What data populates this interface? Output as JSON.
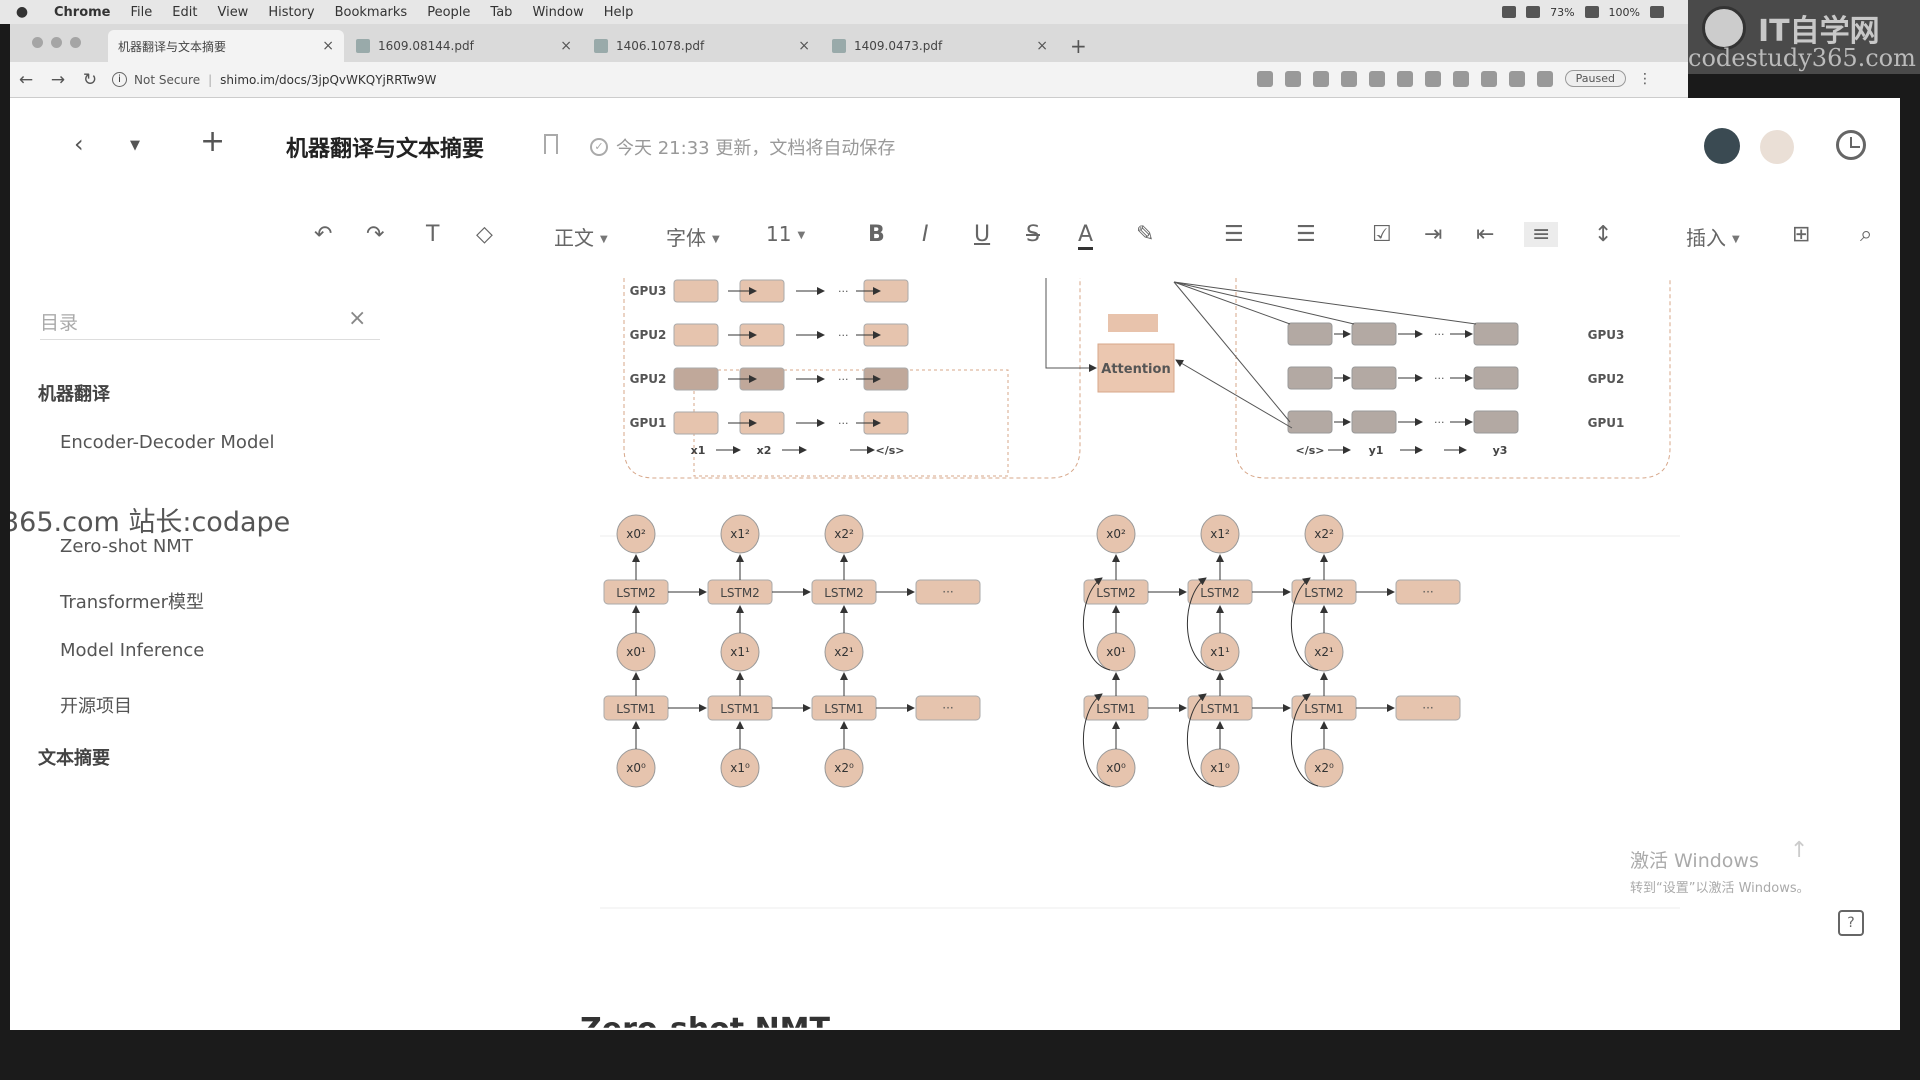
{
  "menubar": {
    "apple": "",
    "items": [
      "Chrome",
      "File",
      "Edit",
      "View",
      "History",
      "Bookmarks",
      "People",
      "Tab",
      "Window",
      "Help"
    ],
    "status": {
      "battery_pct": "73%",
      "zoom": "100%"
    }
  },
  "tabs": [
    {
      "label": "机器翻译与文本摘要",
      "active": true
    },
    {
      "label": "1609.08144.pdf",
      "active": false
    },
    {
      "label": "1406.1078.pdf",
      "active": false
    },
    {
      "label": "1409.0473.pdf",
      "active": false
    }
  ],
  "newtab": "+",
  "address": {
    "not_secure": "Not Secure",
    "url": "shimo.im/docs/3jpQvWKQYjRRTw9W"
  },
  "extensions": {
    "paused": "Paused"
  },
  "watermark": {
    "site_cn": "IT自学网",
    "site_en": "codestudy365.com",
    "overlay": "365.com 站长:codape"
  },
  "doc": {
    "title": "机器翻译与文本摘要",
    "save_status": "今天 21:33 更新，文档将自动保存"
  },
  "editor_toolbar": {
    "style": "正文",
    "font": "字体",
    "size": "11",
    "bold": "B",
    "italic": "I",
    "underline": "U",
    "strike": "S",
    "color": "A",
    "insert": "插入"
  },
  "toc": {
    "placeholder": "目录",
    "items": [
      {
        "label": "机器翻译",
        "level": 1
      },
      {
        "label": "Encoder-Decoder Model",
        "level": 2
      },
      {
        "label": "Zero-shot NMT",
        "level": 2
      },
      {
        "label": "Transformer模型",
        "level": 2
      },
      {
        "label": "Model Inference",
        "level": 2
      },
      {
        "label": "开源项目",
        "level": 2
      },
      {
        "label": "文本摘要",
        "level": 1
      }
    ]
  },
  "figure": {
    "gpu_labels": [
      "GPU3",
      "GPU2",
      "GPU2",
      "GPU1"
    ],
    "gpu_labels_right": [
      "GPU3",
      "GPU2",
      "GPU1"
    ],
    "attention": "Attention",
    "enc_inputs": [
      "x1",
      "x2",
      "</s>"
    ],
    "dec_inputs": [
      "</s>",
      "y1",
      "y3"
    ],
    "lstm_top": "LSTM2",
    "lstm_bottom": "LSTM1",
    "ellipsis": "···",
    "nodes_top": [
      "x0²",
      "x1²",
      "x2²"
    ],
    "nodes_mid": [
      "x0¹",
      "x1¹",
      "x2¹"
    ],
    "nodes_bot": [
      "x0⁰",
      "x1⁰",
      "x2⁰"
    ]
  },
  "windows_activation": {
    "line1": "激活 Windows",
    "line2": "转到“设置”以激活 Windows。"
  },
  "next_heading": "Zero-shot NMT"
}
